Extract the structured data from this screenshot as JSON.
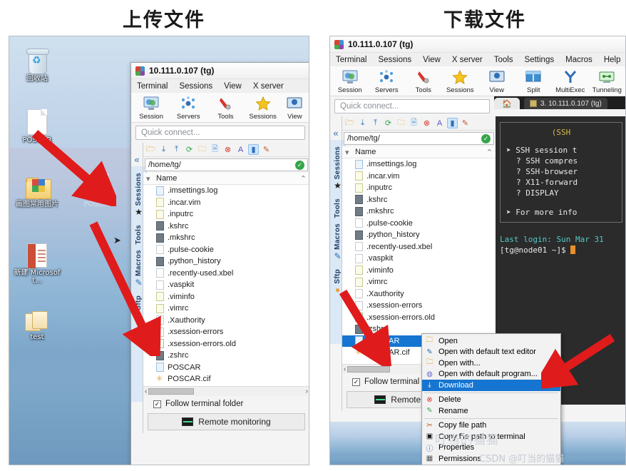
{
  "panels": {
    "left_title": "上传文件",
    "right_title": "下载文件"
  },
  "window": {
    "title": "10.111.0.107 (tg)",
    "menus": [
      "Terminal",
      "Sessions",
      "View",
      "X server",
      "Tools",
      "Settings",
      "Macros",
      "Help"
    ],
    "menus_left": [
      "Terminal",
      "Sessions",
      "View",
      "X server"
    ],
    "toolbar": [
      {
        "label": "Session",
        "icon": "session-icon"
      },
      {
        "label": "Servers",
        "icon": "servers-icon"
      },
      {
        "label": "Tools",
        "icon": "tools-icon"
      },
      {
        "label": "Sessions",
        "icon": "sessions-star-icon"
      },
      {
        "label": "View",
        "icon": "view-icon"
      },
      {
        "label": "Split",
        "icon": "split-icon"
      },
      {
        "label": "MultiExec",
        "icon": "multiexec-icon"
      },
      {
        "label": "Tunneling",
        "icon": "tunneling-icon"
      }
    ],
    "quick_connect_placeholder": "Quick connect...",
    "sidebar_tabs": [
      "Sessions",
      "Tools",
      "Macros",
      "Sftp"
    ],
    "path": "/home/tg/",
    "path_status": "ok",
    "column_header": "Name",
    "sort_indicator": "▾",
    "files": [
      {
        "name": ".imsettings.log",
        "icon": "doc"
      },
      {
        "name": ".incar.vim",
        "icon": "vim"
      },
      {
        "name": ".inputrc",
        "icon": "vim"
      },
      {
        "name": ".kshrc",
        "icon": "cfg"
      },
      {
        "name": ".mkshrc",
        "icon": "cfg"
      },
      {
        "name": ".pulse-cookie",
        "icon": "docw"
      },
      {
        "name": ".python_history",
        "icon": "cfg"
      },
      {
        "name": ".recently-used.xbel",
        "icon": "docw"
      },
      {
        "name": ".vaspkit",
        "icon": "docw"
      },
      {
        "name": ".viminfo",
        "icon": "vim"
      },
      {
        "name": ".vimrc",
        "icon": "vim"
      },
      {
        "name": ".Xauthority",
        "icon": "docw"
      },
      {
        "name": ".xsession-errors",
        "icon": "docw"
      },
      {
        "name": ".xsession-errors.old",
        "icon": "grn"
      },
      {
        "name": ".zshrc",
        "icon": "cfg"
      },
      {
        "name": "POSCAR",
        "icon": "doc"
      },
      {
        "name": "POSCAR.cif",
        "icon": "star"
      }
    ],
    "selected_file": "POSCAR",
    "follow_terminal_label": "Follow terminal folder",
    "follow_terminal_checked": true,
    "remote_monitoring_label": "Remote monitoring",
    "remote_monitoring_short": "Remote",
    "terminal_tab": "3. 10.111.0.107 (tg)",
    "home_tab_icon": "home-icon"
  },
  "terminal": {
    "banner": "(SSH",
    "lines": [
      "➤ SSH session t",
      "? SSH compres",
      "? SSH-browser",
      "? X11-forward",
      "? DISPLAY",
      "➤ For more info"
    ],
    "last_login": "Last login: Sun Mar 31",
    "prompt": "[tg@node01 ~]$"
  },
  "context_menu": {
    "items": [
      {
        "label": "Open",
        "icon": "folder-icon",
        "highlighted": false
      },
      {
        "label": "Open with default text editor",
        "icon": "text-editor-icon",
        "highlighted": false
      },
      {
        "label": "Open with...",
        "icon": "open-with-icon",
        "highlighted": false
      },
      {
        "label": "Open with default program...",
        "icon": "program-icon",
        "highlighted": false
      },
      {
        "label": "Download",
        "icon": "download-icon",
        "highlighted": true
      },
      {
        "sep": true
      },
      {
        "label": "Delete",
        "icon": "delete-icon",
        "highlighted": false
      },
      {
        "label": "Rename",
        "icon": "rename-icon",
        "highlighted": false
      },
      {
        "sep": true
      },
      {
        "label": "Copy file path",
        "icon": "copy-path-icon",
        "highlighted": false
      },
      {
        "label": "Copy file path to terminal",
        "icon": "copy-to-terminal-icon",
        "highlighted": false
      },
      {
        "label": "Properties",
        "icon": "properties-icon",
        "highlighted": false
      },
      {
        "label": "Permissions",
        "icon": "permissions-icon",
        "highlighted": false
      }
    ]
  },
  "desktop": {
    "icons": [
      {
        "label": "回收站",
        "type": "recycle-bin"
      },
      {
        "label": "POSCAR",
        "type": "file"
      },
      {
        "label": "画图常用图片",
        "type": "picture-folder"
      },
      {
        "label": "新建 Microsoft...",
        "type": "powerpoint"
      },
      {
        "label": "test",
        "type": "folder"
      }
    ],
    "drag_ghost_label": "POSCAR"
  },
  "watermarks": {
    "csdn": "CSDN @叮当的猫猫",
    "handle": "叮当的猫猫"
  },
  "colors": {
    "selection": "#1675d1",
    "arrow_red": "#e01b1b",
    "accent_blue": "#2f6fb5",
    "ok_green": "#35a54a",
    "terminal_bg": "#2b2b2b"
  }
}
